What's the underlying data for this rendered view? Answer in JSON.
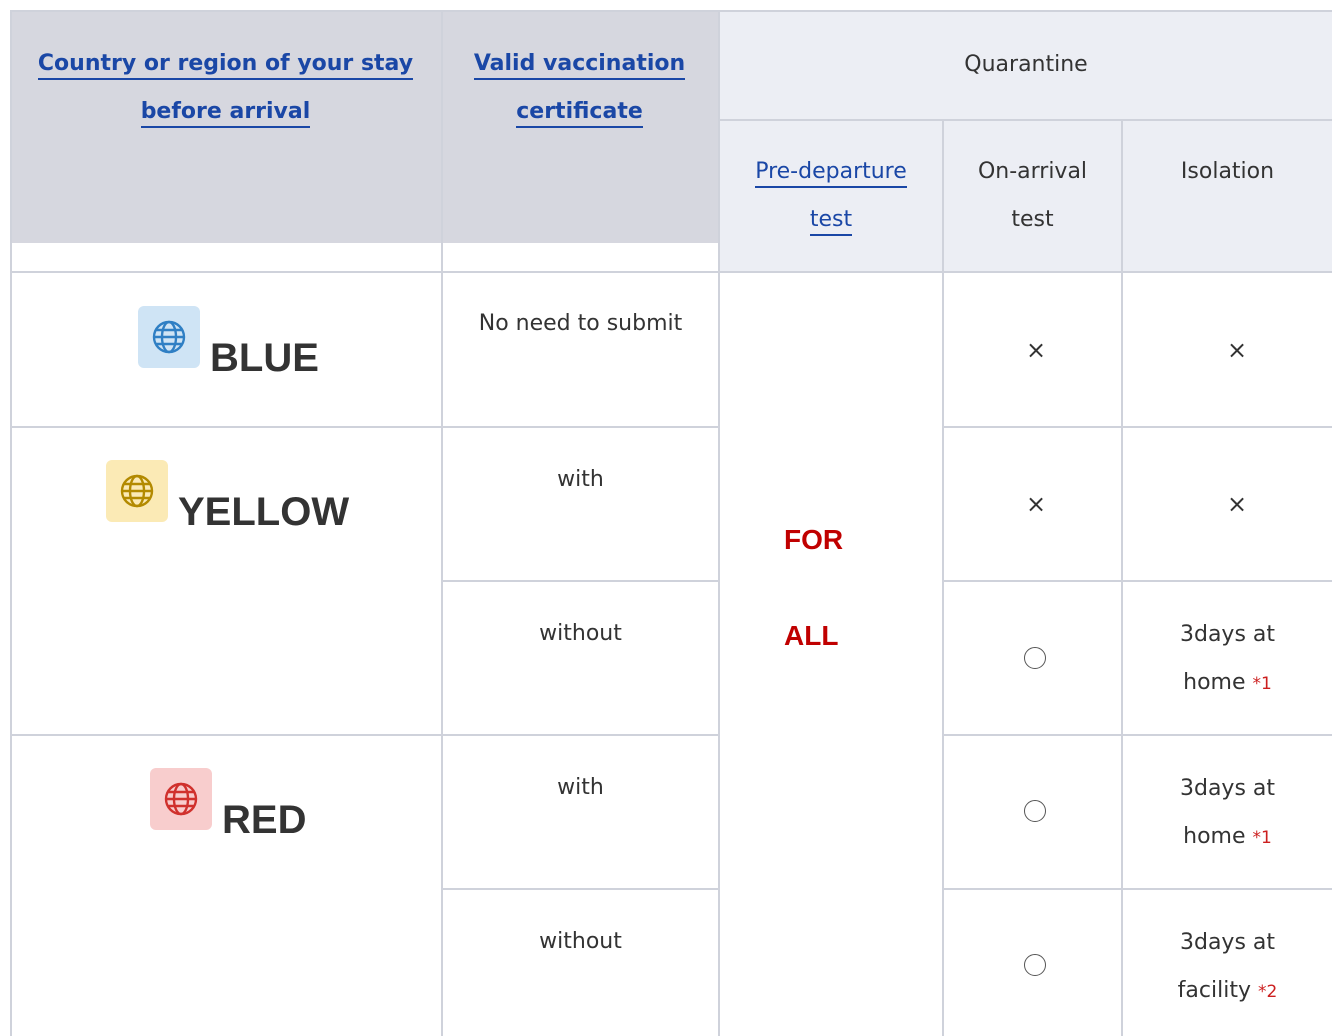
{
  "header": {
    "country_line1": "Country or region of your stay",
    "country_line2": "before arrival",
    "vacc_line1": "Valid vaccination",
    "vacc_line2": "certificate",
    "quarantine": "Quarantine",
    "pre_line1": "Pre-departure",
    "pre_line2": "test",
    "arrival_line1": "On-arrival",
    "arrival_line2": "test",
    "isolation": "Isolation"
  },
  "regions": {
    "blue": {
      "label": "BLUE",
      "color": "#2f7fc4",
      "bg": "#cfe4f5",
      "icon": "globe-icon"
    },
    "yellow": {
      "label": "YELLOW",
      "color": "#b38a00",
      "bg": "#fbeab5",
      "icon": "globe-icon"
    },
    "red": {
      "label": "RED",
      "color": "#d0312d",
      "bg": "#f8cdcd",
      "icon": "globe-icon"
    }
  },
  "predeparture": {
    "line1": "FOR",
    "line2": "ALL",
    "color": "#c00000"
  },
  "rows": [
    {
      "vaccination": "No need to submit",
      "arrival": "×",
      "isolation": "×"
    },
    {
      "vaccination": "with",
      "arrival": "×",
      "isolation": "×"
    },
    {
      "vaccination": "without",
      "arrival": "○",
      "isolation_line1": "3days at",
      "isolation_line2": "home",
      "note": "*1"
    },
    {
      "vaccination": "with",
      "arrival": "○",
      "isolation_line1": "3days at",
      "isolation_line2": "home",
      "note": "*1"
    },
    {
      "vaccination": "without",
      "arrival": "○",
      "isolation_line1": "3days at",
      "isolation_line2": "facility",
      "note": "*2"
    }
  ]
}
